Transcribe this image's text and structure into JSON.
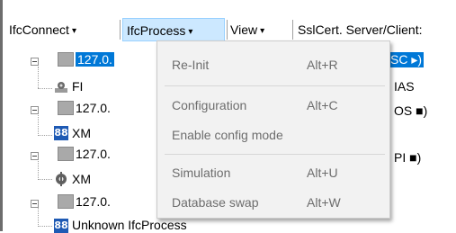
{
  "menubar": {
    "items": [
      {
        "label": "IfcConnect"
      },
      {
        "label": "IfcProcess"
      },
      {
        "label": "View"
      },
      {
        "label": "SslCert. Server/Client:"
      }
    ],
    "caret": "▾"
  },
  "tree": {
    "rows": [
      {
        "label": "127.0.",
        "suffix": "SC ▸)",
        "selected": true
      },
      {
        "label": "FI",
        "suffix": "IAS"
      },
      {
        "label": "127.0.",
        "suffix": "OS ■)"
      },
      {
        "label": "XM"
      },
      {
        "label": "127.0.",
        "suffix": "PI ■)"
      },
      {
        "label": "XM"
      },
      {
        "label": "127.0."
      },
      {
        "label": "Unknown IfcProcess"
      }
    ],
    "xm_glyph": "88"
  },
  "dropdown": {
    "items": [
      {
        "label": "Re-Init",
        "shortcut": "Alt+R"
      },
      {
        "label": "Configuration",
        "shortcut": "Alt+C"
      },
      {
        "label": "Enable config mode",
        "shortcut": ""
      },
      {
        "label": "Simulation",
        "shortcut": "Alt+U"
      },
      {
        "label": "Database swap",
        "shortcut": "Alt+W"
      }
    ]
  }
}
